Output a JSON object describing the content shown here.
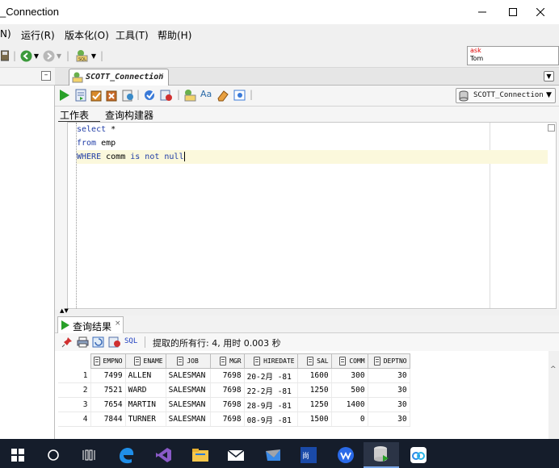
{
  "window": {
    "title": "_Connection",
    "controls": {
      "minimize": "—",
      "maximize": "☐",
      "close": "✕"
    }
  },
  "menu": {
    "items": [
      "N)",
      "运行(R)",
      "版本化(O)",
      "工具(T)",
      "帮助(H)"
    ]
  },
  "toolbar": {
    "ask_box": {
      "line1": "ask",
      "line2": "Tom"
    }
  },
  "document_tab": {
    "label": "SCOTT_Connection",
    "close": "×"
  },
  "connection_selector": {
    "value": "SCOTT_Connection"
  },
  "worksheet_tabs": [
    "工作表",
    "查询构建器"
  ],
  "editor": {
    "lines": [
      {
        "keyword": "select",
        "rest": " *"
      },
      {
        "keyword": "from",
        "rest": " emp"
      },
      {
        "keyword": "WHERE",
        "rest_ident": " comm ",
        "rest_kw": "is not null"
      }
    ],
    "cursor_line": 3
  },
  "results": {
    "tab_label": "查询结果",
    "tab_close": "×",
    "sql_label": "SQL",
    "status": "提取的所有行: 4, 用时 0.003 秒",
    "columns": [
      "EMPNO",
      "ENAME",
      "JOB",
      "MGR",
      "HIREDATE",
      "SAL",
      "COMM",
      "DEPTNO"
    ],
    "rows": [
      {
        "n": "1",
        "empno": "7499",
        "ename": "ALLEN",
        "job": "SALESMAN",
        "mgr": "7698",
        "hiredate": "20-2月 -81",
        "sal": "1600",
        "comm": "300",
        "deptno": "30"
      },
      {
        "n": "2",
        "empno": "7521",
        "ename": "WARD",
        "job": "SALESMAN",
        "mgr": "7698",
        "hiredate": "22-2月 -81",
        "sal": "1250",
        "comm": "500",
        "deptno": "30"
      },
      {
        "n": "3",
        "empno": "7654",
        "ename": "MARTIN",
        "job": "SALESMAN",
        "mgr": "7698",
        "hiredate": "28-9月 -81",
        "sal": "1250",
        "comm": "1400",
        "deptno": "30"
      },
      {
        "n": "4",
        "empno": "7844",
        "ename": "TURNER",
        "job": "SALESMAN",
        "mgr": "7698",
        "hiredate": "08-9月 -81",
        "sal": "1500",
        "comm": "0",
        "deptno": "30"
      }
    ]
  },
  "taskbar": {
    "items": [
      "start",
      "search",
      "task-view",
      "edge",
      "visual-studio",
      "file-explorer",
      "mail",
      "feishu",
      "app-chinese",
      "wps",
      "sql-developer",
      "baidu-netdisk"
    ],
    "active": "sql-developer"
  },
  "colors": {
    "keyword": "#1f3ca6",
    "current_line": "#fbf8dc",
    "taskbar": "#151d2b",
    "ask_red": "#d00000"
  }
}
